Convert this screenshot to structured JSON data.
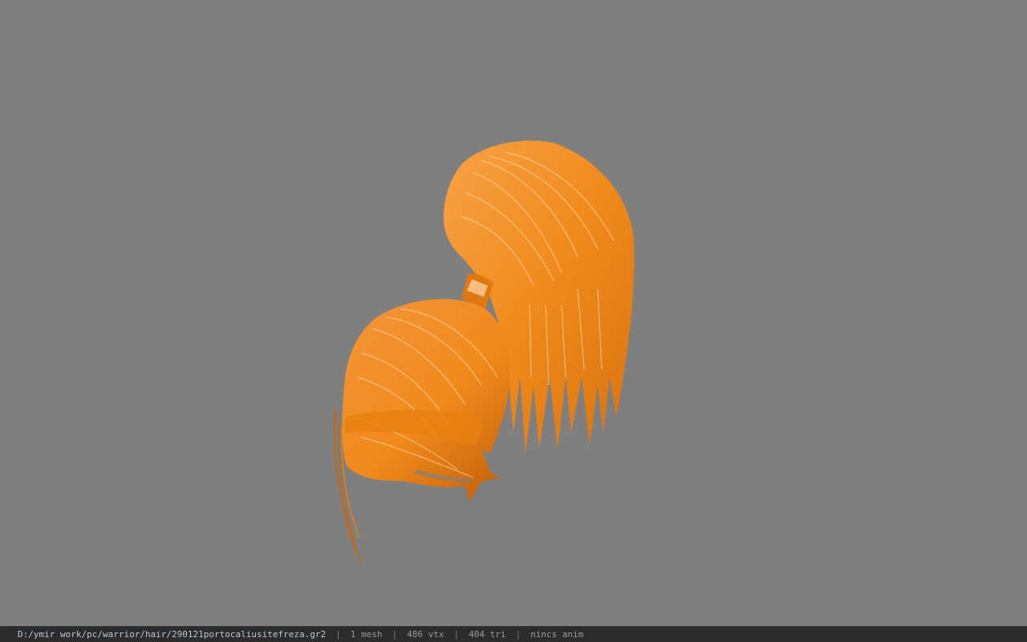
{
  "viewport": {
    "background_color": "#7f7f7f",
    "model_color": "#f08a1c",
    "model_highlight_color": "#ffd9ad",
    "model_shadow_color": "#c9660c"
  },
  "statusbar": {
    "file_path": "D:/ymir work/pc/warrior/hair/290121portocaliusitefreza.gr2",
    "separator": "|",
    "mesh_count": "1 mesh",
    "vertex_count": "486 vtx",
    "triangle_count": "404 tri",
    "animation_status": "nincs anim"
  }
}
